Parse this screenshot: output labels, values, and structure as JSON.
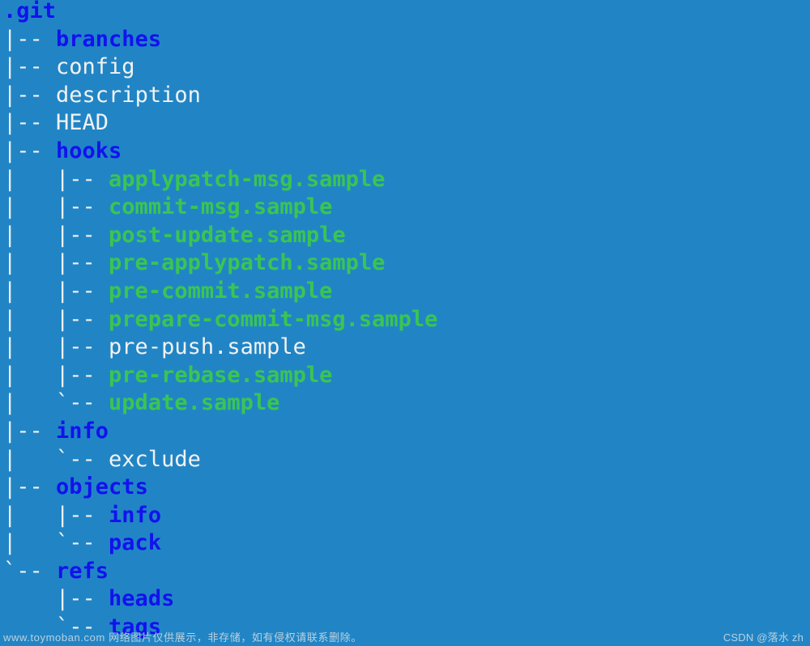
{
  "theme": {
    "background": "#2185c5",
    "directory_color": "#1212ee",
    "file_color": "#f2f2f2",
    "executable_color": "#3ac552",
    "connector_color": "#f2f2f2",
    "watermark_color": "#d6dee3"
  },
  "tree": {
    "root": ".git",
    "rows": [
      {
        "connector": "",
        "name": ".git",
        "kind": "root"
      },
      {
        "connector": "|-- ",
        "name": "branches",
        "kind": "dir"
      },
      {
        "connector": "|-- ",
        "name": "config",
        "kind": "file"
      },
      {
        "connector": "|-- ",
        "name": "description",
        "kind": "file"
      },
      {
        "connector": "|-- ",
        "name": "HEAD",
        "kind": "file"
      },
      {
        "connector": "|-- ",
        "name": "hooks",
        "kind": "dir"
      },
      {
        "connector": "|   |-- ",
        "name": "applypatch-msg.sample",
        "kind": "exec"
      },
      {
        "connector": "|   |-- ",
        "name": "commit-msg.sample",
        "kind": "exec"
      },
      {
        "connector": "|   |-- ",
        "name": "post-update.sample",
        "kind": "exec"
      },
      {
        "connector": "|   |-- ",
        "name": "pre-applypatch.sample",
        "kind": "exec"
      },
      {
        "connector": "|   |-- ",
        "name": "pre-commit.sample",
        "kind": "exec"
      },
      {
        "connector": "|   |-- ",
        "name": "prepare-commit-msg.sample",
        "kind": "exec"
      },
      {
        "connector": "|   |-- ",
        "name": "pre-push.sample",
        "kind": "file"
      },
      {
        "connector": "|   |-- ",
        "name": "pre-rebase.sample",
        "kind": "exec"
      },
      {
        "connector": "|   `-- ",
        "name": "update.sample",
        "kind": "exec"
      },
      {
        "connector": "|-- ",
        "name": "info",
        "kind": "dir"
      },
      {
        "connector": "|   `-- ",
        "name": "exclude",
        "kind": "file"
      },
      {
        "connector": "|-- ",
        "name": "objects",
        "kind": "dir"
      },
      {
        "connector": "|   |-- ",
        "name": "info",
        "kind": "dir"
      },
      {
        "connector": "|   `-- ",
        "name": "pack",
        "kind": "dir"
      },
      {
        "connector": "`-- ",
        "name": "refs",
        "kind": "dir"
      },
      {
        "connector": "    |-- ",
        "name": "heads",
        "kind": "dir"
      },
      {
        "connector": "    `-- ",
        "name": "tags",
        "kind": "dir"
      }
    ]
  },
  "watermarks": {
    "left": "www.toymoban.com 网络图片仅供展示，非存储，如有侵权请联系删除。",
    "right": "CSDN @落水 zh"
  }
}
